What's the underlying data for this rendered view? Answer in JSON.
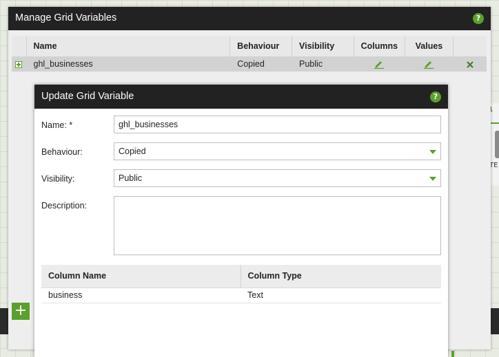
{
  "background": {
    "partial_label_number": "1",
    "partial_label_text": "TE"
  },
  "manage_dialog": {
    "title": "Manage Grid Variables",
    "help_icon": "?",
    "columns": {
      "name": "Name",
      "behaviour": "Behaviour",
      "visibility": "Visibility",
      "columns": "Columns",
      "values": "Values"
    },
    "rows": [
      {
        "name": "ghl_businesses",
        "behaviour": "Copied",
        "visibility": "Public",
        "columns_icon": "pencil-icon",
        "values_icon": "pencil-icon",
        "delete_icon": "close-icon"
      }
    ],
    "add_button": "+"
  },
  "update_dialog": {
    "title": "Update Grid Variable",
    "help_icon": "?",
    "name_label": "Name: *",
    "name_value": "ghl_businesses",
    "behaviour_label": "Behaviour:",
    "behaviour_value": "Copied",
    "visibility_label": "Visibility:",
    "visibility_value": "Public",
    "description_label": "Description:",
    "description_value": "",
    "columns_table": {
      "headers": [
        "Column Name",
        "Column Type"
      ],
      "rows": [
        [
          "business",
          "Text"
        ]
      ]
    }
  },
  "colors": {
    "accent_green": "#5aa02c",
    "header_dark": "#222222"
  }
}
